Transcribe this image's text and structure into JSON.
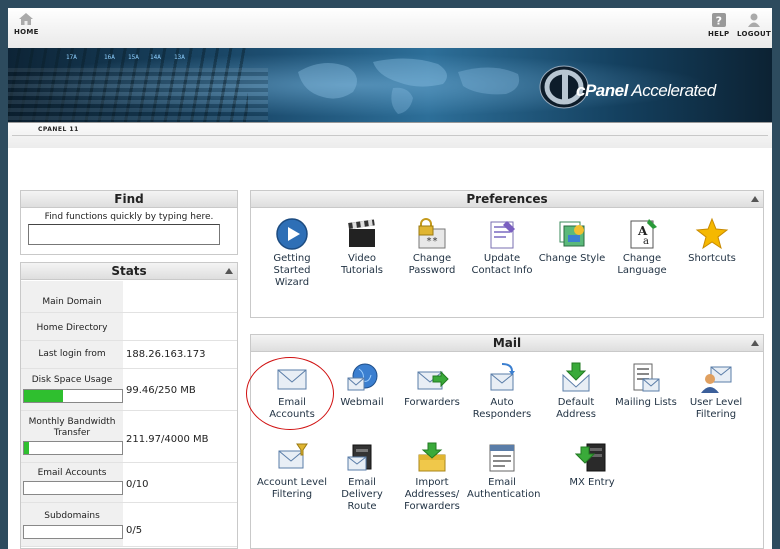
{
  "nav": {
    "home_label": "HOME",
    "help_label": "HELP",
    "logout_label": "LOGOUT"
  },
  "banner": {
    "brand_prefix": "cPanel",
    "brand_suffix": "Accelerated",
    "rack_numbers": [
      "17A",
      "16A",
      "15A",
      "14A",
      "13A"
    ]
  },
  "subbar": {
    "tag": "CPANEL 11"
  },
  "find": {
    "title": "Find",
    "description": "Find functions quickly by typing here.",
    "input_value": ""
  },
  "stats": {
    "title": "Stats",
    "rows": [
      {
        "label": "Main Domain",
        "value": ""
      },
      {
        "label": "Home Directory",
        "value": ""
      },
      {
        "label": "Last login from",
        "value": "188.26.163.173"
      },
      {
        "label": "Disk Space Usage",
        "value": "99.46/250 MB",
        "fraction": 0.3978
      },
      {
        "label": "Monthly Bandwidth Transfer",
        "value": "211.97/4000 MB",
        "fraction": 0.053
      },
      {
        "label": "Email Accounts",
        "value": "0/10",
        "fraction": 0
      },
      {
        "label": "Subdomains",
        "value": "0/5",
        "fraction": 0
      }
    ]
  },
  "preferences": {
    "title": "Preferences",
    "items": [
      {
        "label": "Getting Started Wizard",
        "icon": "play-circle-icon"
      },
      {
        "label": "Video Tutorials",
        "icon": "clapperboard-icon"
      },
      {
        "label": "Change Password",
        "icon": "lock-password-icon"
      },
      {
        "label": "Update Contact Info",
        "icon": "contact-card-icon"
      },
      {
        "label": "Change Style",
        "icon": "style-palette-icon"
      },
      {
        "label": "Change Language",
        "icon": "language-document-icon"
      },
      {
        "label": "Shortcuts",
        "icon": "star-icon"
      }
    ]
  },
  "mail": {
    "title": "Mail",
    "items": [
      {
        "label": "Email Accounts",
        "icon": "envelope-icon"
      },
      {
        "label": "Webmail",
        "icon": "globe-envelope-icon"
      },
      {
        "label": "Forwarders",
        "icon": "forward-envelope-icon"
      },
      {
        "label": "Auto Responders",
        "icon": "auto-responder-icon"
      },
      {
        "label": "Default Address",
        "icon": "default-address-icon"
      },
      {
        "label": "Mailing Lists",
        "icon": "mailing-list-icon"
      },
      {
        "label": "User Level Filtering",
        "icon": "user-filter-icon"
      },
      {
        "label": "Account Level Filtering",
        "icon": "account-filter-icon"
      },
      {
        "label": "Email Delivery Route",
        "icon": "delivery-route-icon"
      },
      {
        "label": "Import Addresses/ Forwarders",
        "icon": "import-addresses-icon"
      },
      {
        "label": "Email Authentication",
        "icon": "email-authentication-icon"
      },
      {
        "label": "MX Entry",
        "icon": "mx-entry-icon"
      }
    ]
  },
  "colors": {
    "highlight_circle": "#d01010",
    "usage_bar": "#2fbf2f"
  }
}
